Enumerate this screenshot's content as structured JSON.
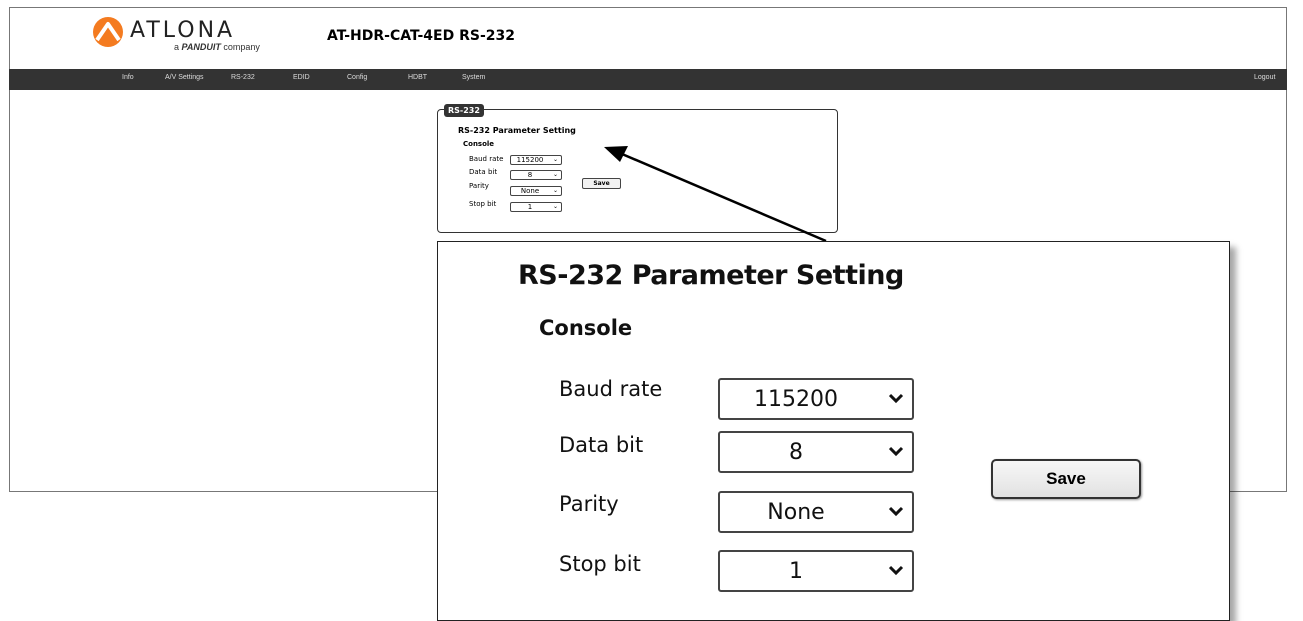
{
  "brand": {
    "name": "ATLONA",
    "tagline_prefix": "a",
    "tagline_brand": "PANDUIT",
    "tagline_suffix": "company",
    "accent": "#f47b20"
  },
  "header": {
    "title": "AT-HDR-CAT-4ED  RS-232"
  },
  "nav": {
    "items": [
      "Info",
      "A/V Settings",
      "RS-232",
      "EDID",
      "Config",
      "HDBT",
      "System"
    ],
    "logout": "Logout",
    "bar_color": "#333333"
  },
  "panel": {
    "tab": "RS-232",
    "heading": "RS-232 Parameter Setting",
    "subheading": "Console",
    "fields": [
      {
        "label": "Baud rate",
        "value": "115200"
      },
      {
        "label": "Data bit",
        "value": "8"
      },
      {
        "label": "Parity",
        "value": "None"
      },
      {
        "label": "Stop bit",
        "value": "1"
      }
    ],
    "save": "Save"
  },
  "zoom": {
    "heading": "RS-232 Parameter Setting",
    "subheading": "Console",
    "fields": [
      {
        "label": "Baud rate",
        "value": "115200"
      },
      {
        "label": "Data bit",
        "value": "8"
      },
      {
        "label": "Parity",
        "value": "None"
      },
      {
        "label": "Stop bit",
        "value": "1"
      }
    ],
    "save": "Save"
  },
  "icons": {
    "chevron": "chevron-down-icon",
    "logo": "atlona-logo-icon",
    "callout": "callout-arrow"
  }
}
